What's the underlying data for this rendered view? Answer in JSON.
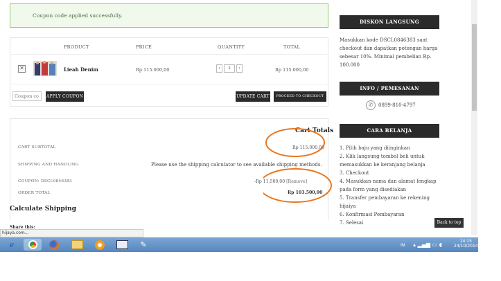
{
  "notice": "Coupon code applied successfully.",
  "cart": {
    "headers": [
      "PRODUCT",
      "PRICE",
      "QUANTITY",
      "TOTAL"
    ],
    "item": {
      "remove": "✕",
      "name": "Lieah Denim",
      "price": "Rp 115.000,00",
      "qty": "1",
      "total": "Rp 115.000,00"
    },
    "coupon_placeholder": "Coupon co",
    "apply_coupon": "APPLY COUPON",
    "update_cart": "UPDATE CART",
    "checkout": "PROCEED TO CHECKOUT"
  },
  "totals": {
    "title": "Cart Totals",
    "subtotal_label": "CART SUBTOTAL",
    "subtotal_value": "Rp 115.000,00",
    "shipping_label": "SHIPPING AND HANDLING",
    "shipping_value": "Please use the shipping calculator to see available shipping methods.",
    "coupon_label": "COUPON: DSCL0846383",
    "coupon_value": "-Rp 11.500,00",
    "coupon_remove": "[Remove]",
    "order_label": "ORDER TOTAL",
    "order_value": "Rp 103.500,00"
  },
  "calc_title": "Calculate Shipping",
  "share": "Share this:",
  "sidebar": {
    "diskon_title": "DISKON LANGSUNG",
    "diskon_text": "Masukkan kode DSCL0846383 saat checkout dan dapatkan potongan harga sebesar 10%. Minimal pembelian Rp. 100.000",
    "info_title": "INFO / PEMESANAN",
    "phone": "0899-810-4797",
    "cara_title": "CARA BELANJA",
    "steps": [
      "1. Pilih baju yang diinginkan",
      "2. Klik langsung tombol beli untuk memasukkan ke keranjang belanja",
      "3. Checkout",
      "4. Masukkan nama dan alamat lengkap pada form yang disediakan",
      "5. Transfer pembayaran ke rekening hijaiya",
      "6. Konfirmasi Pembayaran",
      "7. Selesai"
    ]
  },
  "back_to_top": "Back to top",
  "status_url": "hijaya.com...",
  "taskbar": {
    "lang": "IN",
    "time": "14:15",
    "date": "24/10/2014"
  },
  "colors": {
    "annotation": "#e8761e",
    "notice_border": "#8fca6f",
    "dark": "#2b2b2b"
  }
}
